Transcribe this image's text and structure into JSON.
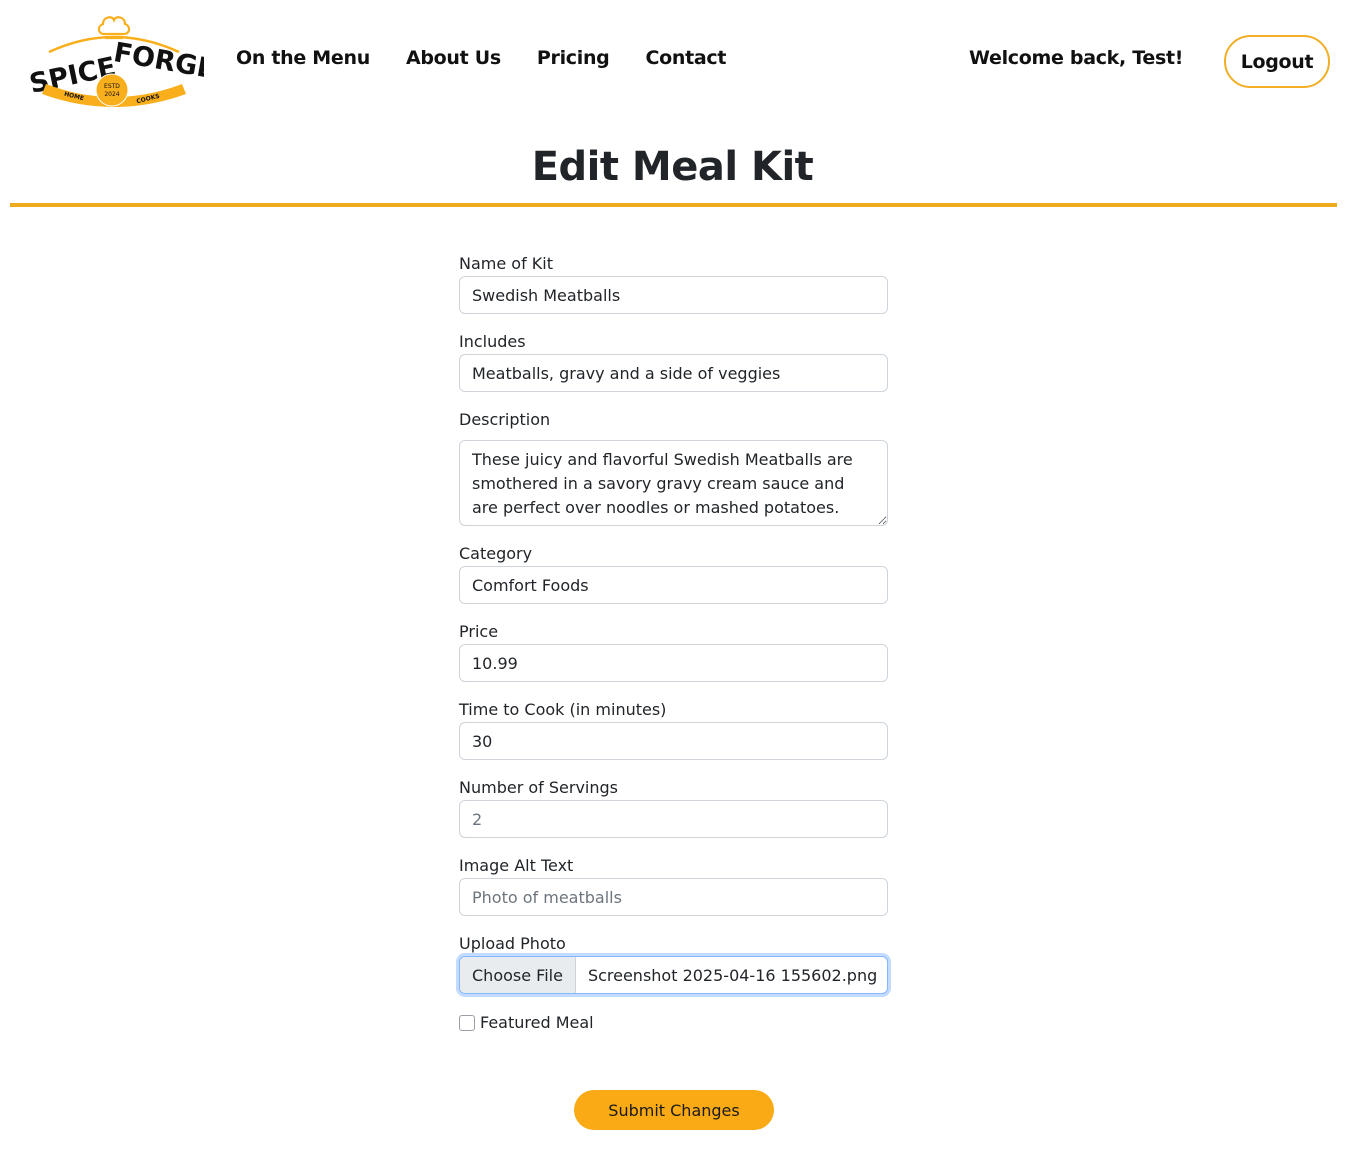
{
  "brand": {
    "name_part1": "SPICE",
    "name_part2": "FORGE",
    "estd": "ESTD",
    "year": "2024",
    "ribbon_left": "HOME",
    "ribbon_right": "COOKS",
    "color_yellow": "#f9ae1b",
    "color_dark": "#111111"
  },
  "nav": {
    "items": [
      {
        "label": "On the Menu"
      },
      {
        "label": "About Us"
      },
      {
        "label": "Pricing"
      },
      {
        "label": "Contact"
      }
    ]
  },
  "user": {
    "welcome": "Welcome back, Test!",
    "logout_label": "Logout"
  },
  "page": {
    "title": "Edit Meal Kit",
    "accent_color": "#eeab1e"
  },
  "form": {
    "name": {
      "label": "Name of Kit",
      "value": "Swedish Meatballs"
    },
    "includes": {
      "label": "Includes",
      "value": "Meatballs, gravy and a side of veggies"
    },
    "description": {
      "label": "Description",
      "value": "These juicy and flavorful Swedish Meatballs are smothered in a savory gravy cream sauce and are perfect over noodles or mashed potatoes."
    },
    "category": {
      "label": "Category",
      "value": "Comfort Foods"
    },
    "price": {
      "label": "Price",
      "value": "10.99"
    },
    "time": {
      "label": "Time to Cook (in minutes)",
      "value": "30"
    },
    "servings": {
      "label": "Number of Servings",
      "placeholder": "2"
    },
    "alt_text": {
      "label": "Image Alt Text",
      "placeholder": "Photo of meatballs"
    },
    "upload": {
      "label": "Upload Photo",
      "button": "Choose File",
      "filename": "Screenshot 2025-04-16 155602.png"
    },
    "featured": {
      "label": "Featured Meal",
      "checked": false
    },
    "submit_label": "Submit Changes"
  }
}
